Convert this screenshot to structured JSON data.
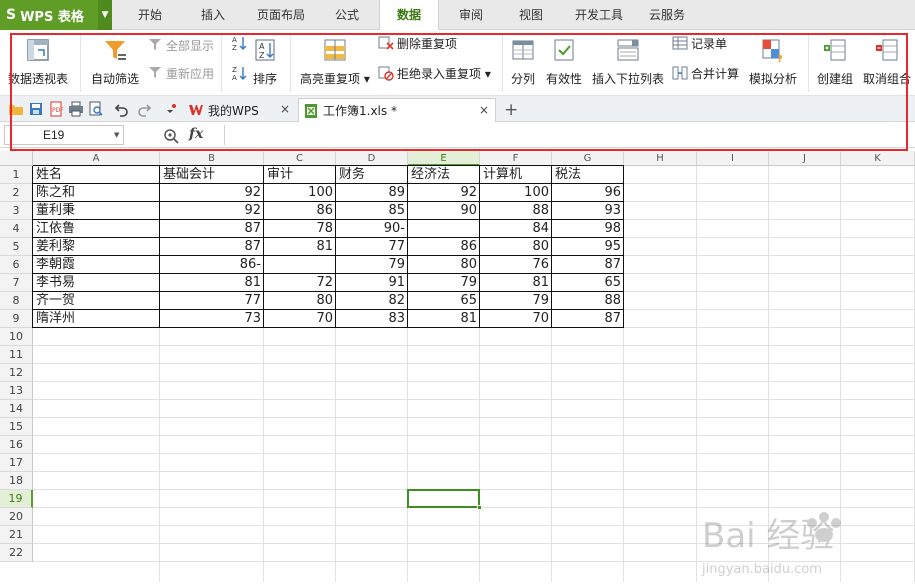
{
  "app": {
    "logo": "S",
    "title": "WPS 表格"
  },
  "menu_tabs": [
    "开始",
    "插入",
    "页面布局",
    "公式",
    "数据",
    "审阅",
    "视图",
    "开发工具",
    "云服务"
  ],
  "active_menu_tab": "数据",
  "ribbon": {
    "pivot_table": "数据透视表",
    "auto_filter": "自动筛选",
    "show_all": "全部显示",
    "reapply": "重新应用",
    "sort": "排序",
    "highlight_duplicates": "高亮重复项",
    "remove_duplicates": "删除重复项",
    "reject_duplicate_entry": "拒绝录入重复项",
    "text_to_columns": "分列",
    "validation": "有效性",
    "insert_dropdown": "插入下拉列表",
    "record_form": "记录单",
    "consolidate": "合并计算",
    "what_if": "模拟分析",
    "group": "创建组",
    "ungroup": "取消组合"
  },
  "doc_tabs": [
    {
      "label": "我的WPS",
      "close": "×"
    },
    {
      "label": "工作簿1.xls *",
      "close": "×"
    }
  ],
  "new_tab": "+",
  "formula_bar": {
    "name_box": "E19",
    "fx": "fx",
    "formula": ""
  },
  "columns": [
    "A",
    "B",
    "C",
    "D",
    "E",
    "F",
    "G",
    "H",
    "I",
    "J",
    "K"
  ],
  "rows": [
    "1",
    "2",
    "3",
    "4",
    "5",
    "6",
    "7",
    "8",
    "9",
    "10",
    "11",
    "12",
    "13",
    "14",
    "15",
    "16",
    "17",
    "18",
    "19",
    "20",
    "21",
    "22"
  ],
  "selected_cell": {
    "column": "E",
    "row": "19"
  },
  "sheet": {
    "headers": [
      "姓名",
      "基础会计",
      "审计",
      "财务",
      "经济法",
      "计算机",
      "税法"
    ],
    "records": [
      [
        "陈之和",
        "92",
        "100",
        "89",
        "92",
        "100",
        "96"
      ],
      [
        "董利秉",
        "92",
        "86",
        "85",
        "90",
        "88",
        "93"
      ],
      [
        "江依鲁",
        "87",
        "78",
        "90-",
        "",
        "84",
        "98"
      ],
      [
        "姜利黎",
        "87",
        "81",
        "77",
        "86",
        "80",
        "95"
      ],
      [
        "李朝霞",
        "86-",
        "",
        "79",
        "80",
        "76",
        "87"
      ],
      [
        "李书易",
        "81",
        "72",
        "91",
        "79",
        "81",
        "65"
      ],
      [
        "齐一贺",
        "77",
        "80",
        "82",
        "65",
        "79",
        "88"
      ],
      [
        "隋洋州",
        "73",
        "70",
        "83",
        "81",
        "70",
        "87"
      ]
    ]
  },
  "watermark": {
    "brand": "Bai 经验",
    "url": "jingyan.baidu.com"
  },
  "colors": {
    "menu_green": "#5f9d27",
    "highlight_red": "#e8282f",
    "selection_green": "#3d8f1f"
  }
}
